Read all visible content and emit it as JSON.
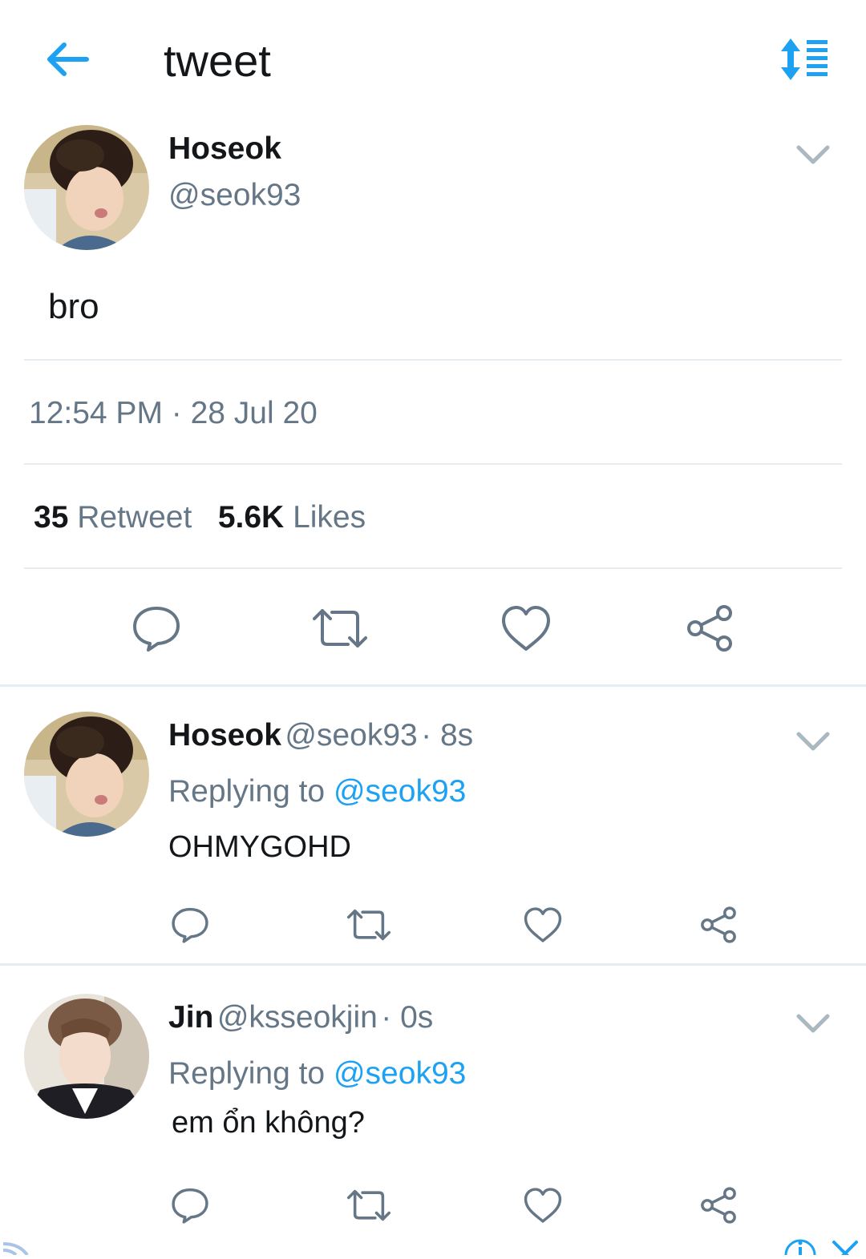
{
  "header": {
    "title": "tweet",
    "back_icon": "arrow-left-icon",
    "sort_icon": "sort-list-icon",
    "accent": "#1da1f2"
  },
  "main_tweet": {
    "author_name": "Hoseok",
    "author_handle": "@seok93",
    "text": "bro",
    "timestamp": "12:54 PM · 28 Jul 20",
    "retweet_count": "35",
    "retweet_label": "Retweet",
    "likes_count": "5.6K",
    "likes_label": "Likes"
  },
  "replies": [
    {
      "author_name": "Hoseok",
      "author_handle": "@seok93",
      "time": "· 8s",
      "replying_label": "Replying to",
      "replying_to": "@seok93",
      "text": "OHMYGOHD"
    },
    {
      "author_name": "Jin",
      "author_handle": "@ksseokjin",
      "time": "· 0s",
      "replying_label": "Replying to",
      "replying_to": "@seok93",
      "text": "em ổn không?"
    }
  ],
  "colors": {
    "text_primary": "#14171a",
    "text_secondary": "#657786",
    "link": "#1da1f2",
    "divider": "#e6ecf0",
    "icon_gray": "#657786"
  }
}
